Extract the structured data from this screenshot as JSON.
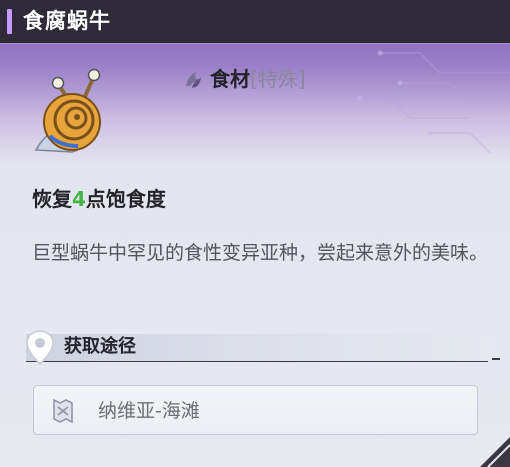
{
  "item": {
    "name": "食腐蜗牛",
    "type_label": "食材",
    "type_tag": "[特殊]",
    "effect_prefix": "恢复",
    "effect_value": "4",
    "effect_suffix": "点饱食度",
    "description": "巨型蜗牛中罕见的食性变异亚种，尝起来意外的美味。"
  },
  "source": {
    "title": "获取途径",
    "locations": [
      "纳维亚-海滩"
    ]
  },
  "icons": {
    "item": "snail-icon",
    "type": "ingredient-icon",
    "source": "location-pin-icon",
    "location": "map-marker-icon"
  },
  "colors": {
    "accent": "#c69aff",
    "highlight_number": "#44b649",
    "header_bg": "#2f2a37",
    "card_top": "#7b58b6"
  }
}
